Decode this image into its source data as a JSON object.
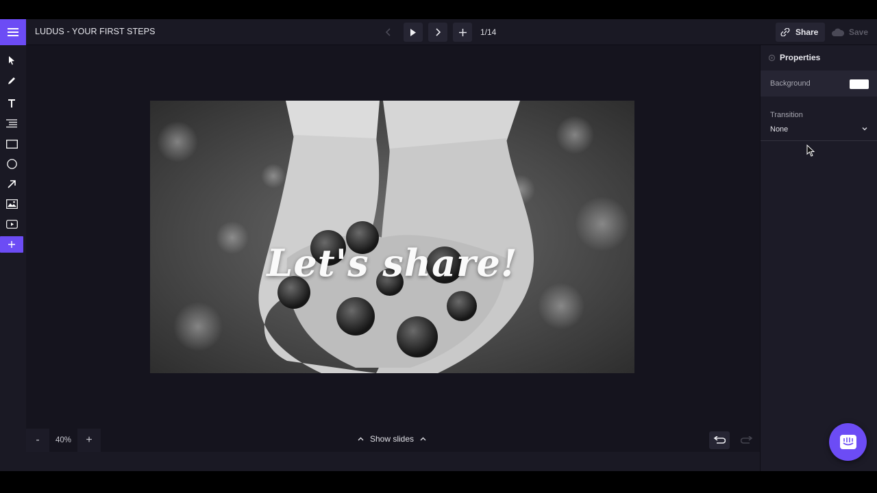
{
  "header": {
    "doc_title": "LUDUS - YOUR FIRST STEPS",
    "slide_counter": "1/14",
    "share_label": "Share",
    "save_label": "Save"
  },
  "toolbar": {
    "tools": [
      "select-icon",
      "pen-icon",
      "text-icon",
      "list-icon",
      "rectangle-icon",
      "ellipse-icon",
      "arrow-icon",
      "image-icon",
      "video-icon",
      "add-icon"
    ]
  },
  "slide": {
    "text": "Let's share!"
  },
  "canvas_footer": {
    "zoom_minus": "-",
    "zoom_level": "40%",
    "zoom_plus": "+",
    "show_slides_label": "Show slides"
  },
  "properties": {
    "title": "Properties",
    "background_label": "Background",
    "background_color": "#ffffff",
    "transition_label": "Transition",
    "transition_value": "None"
  },
  "colors": {
    "accent": "#6c4cf5",
    "app_bg": "#16151f",
    "panel_bg": "#1c1b27"
  }
}
